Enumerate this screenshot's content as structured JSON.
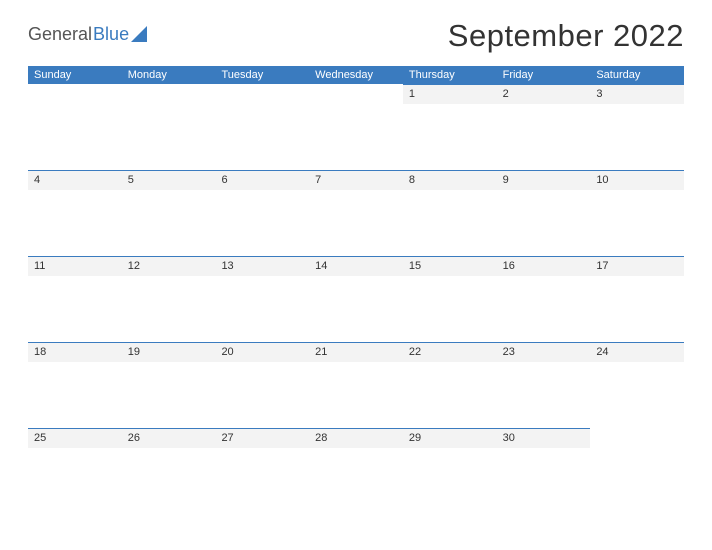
{
  "brand": {
    "word1": "General",
    "word2": "Blue"
  },
  "title": "September 2022",
  "daynames": [
    "Sunday",
    "Monday",
    "Tuesday",
    "Wednesday",
    "Thursday",
    "Friday",
    "Saturday"
  ],
  "weeks": [
    [
      "",
      "",
      "",
      "",
      "1",
      "2",
      "3"
    ],
    [
      "4",
      "5",
      "6",
      "7",
      "8",
      "9",
      "10"
    ],
    [
      "11",
      "12",
      "13",
      "14",
      "15",
      "16",
      "17"
    ],
    [
      "18",
      "19",
      "20",
      "21",
      "22",
      "23",
      "24"
    ],
    [
      "25",
      "26",
      "27",
      "28",
      "29",
      "30",
      ""
    ]
  ],
  "colors": {
    "accent": "#3a7bbf",
    "stripe": "#f3f3f3"
  }
}
